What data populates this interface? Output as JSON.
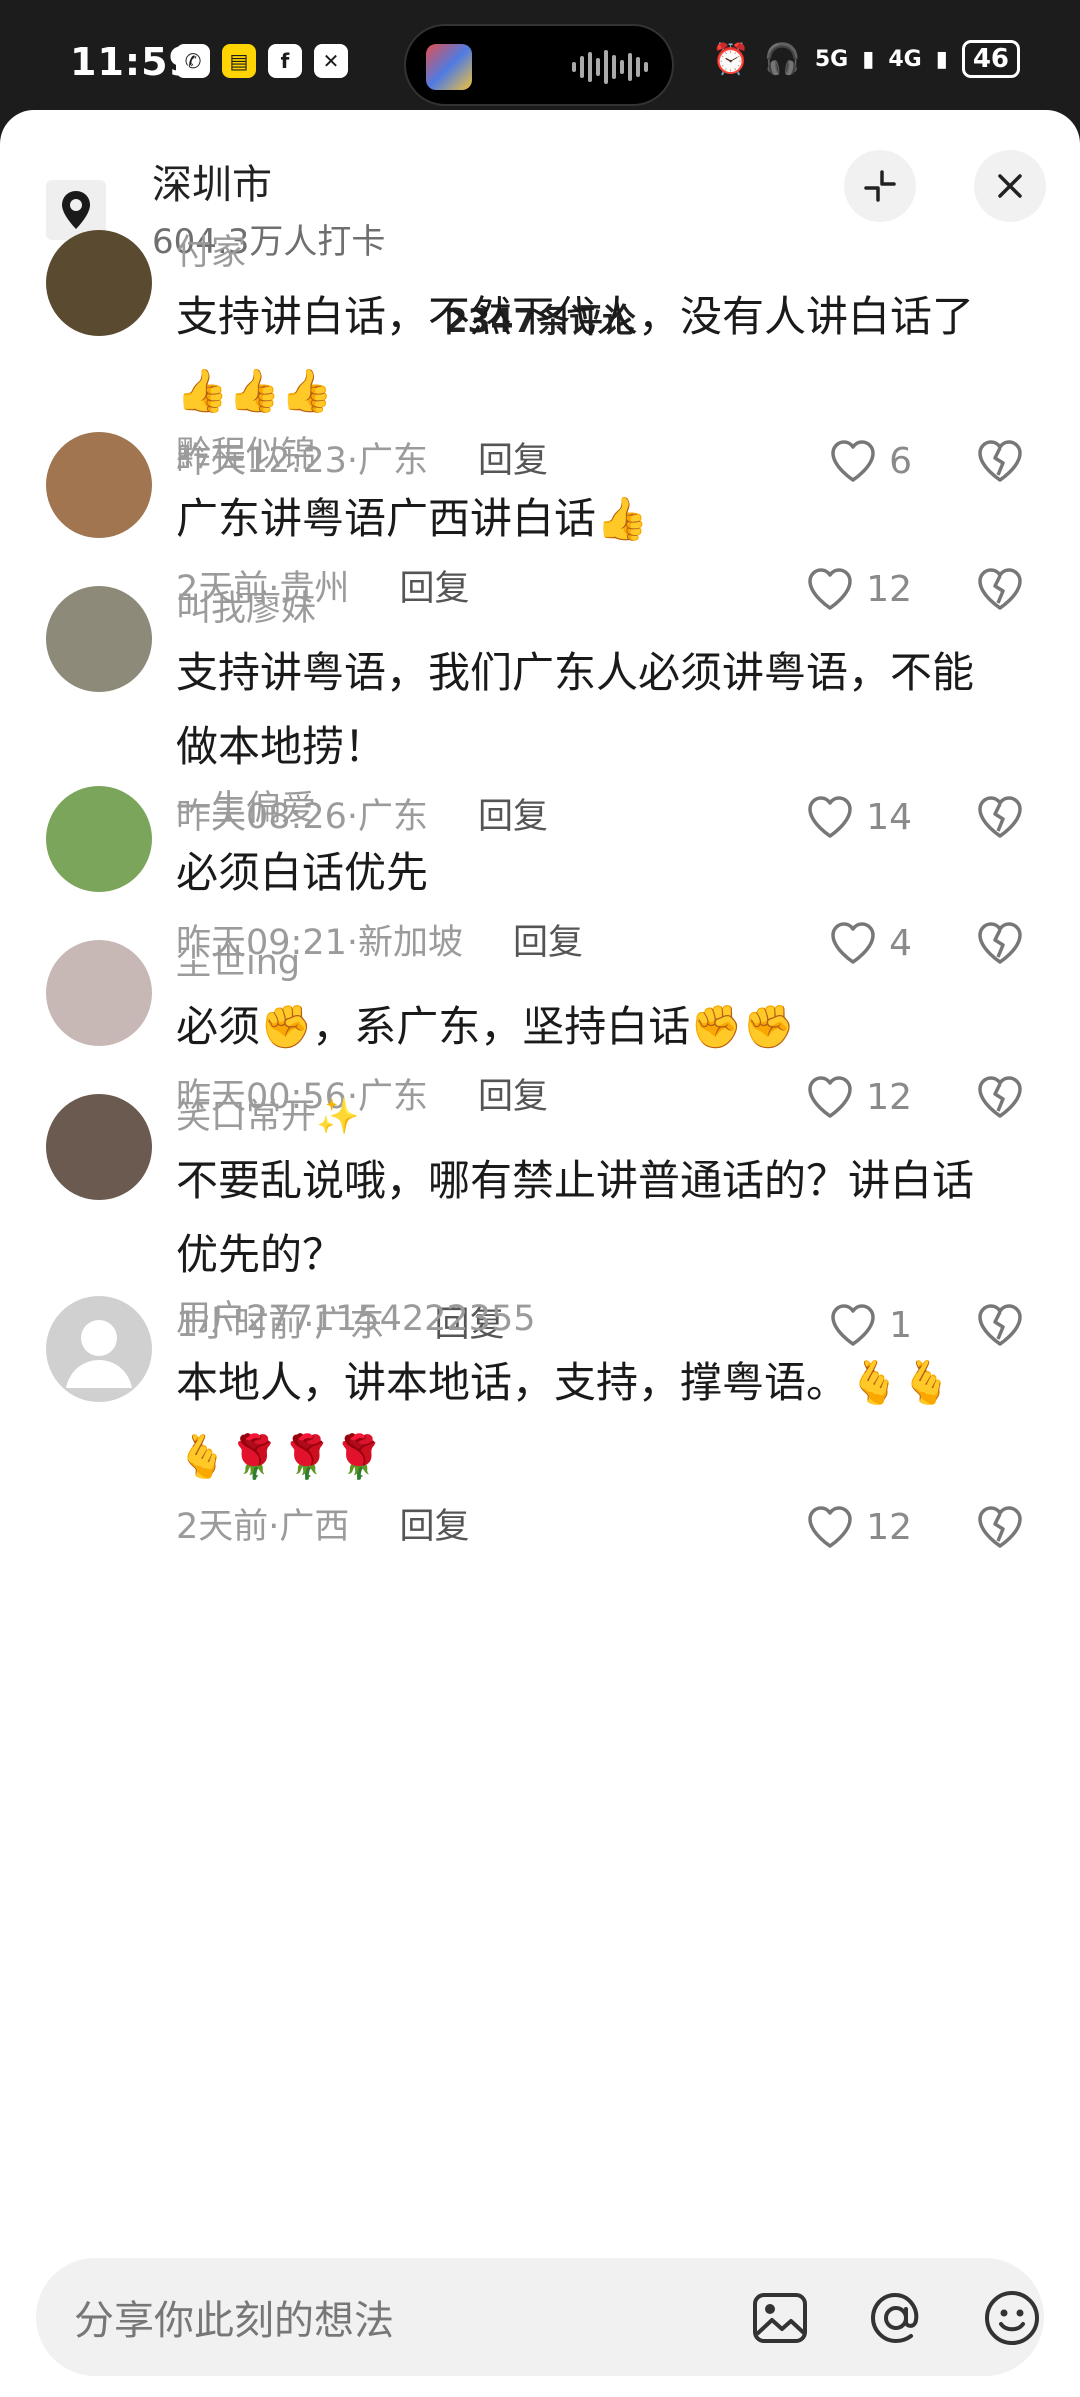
{
  "status_bar": {
    "time": "11:59",
    "battery": "46",
    "network_1": "5G",
    "network_2": "4G"
  },
  "header": {
    "location_name": "深圳市",
    "checkins": "604.3万人打卡",
    "comment_count": "2347条评论"
  },
  "comments": [
    {
      "user": "付家",
      "text_lines": [
        "支持讲白话，不然下代人，没有人讲白话了",
        "👍👍👍"
      ],
      "time": "昨天12:23",
      "region": "广东",
      "reply": "回复",
      "likes": "6",
      "avatar_color": "#5a4a30"
    },
    {
      "user": "黔程似锦",
      "text_lines": [
        "广东讲粤语广西讲白话👍"
      ],
      "time": "2天前",
      "region": "贵州",
      "reply": "回复",
      "likes": "12",
      "avatar_color": "#a07550"
    },
    {
      "user": "叫我廖妹",
      "text_lines": [
        "支持讲粤语，我们广东人必须讲粤语，不能",
        "做本地捞！"
      ],
      "time": "昨天08:26",
      "region": "广东",
      "reply": "回复",
      "likes": "14",
      "avatar_color": "#8d8a7a"
    },
    {
      "user": "一生偏爱",
      "text_lines": [
        "必须白话优先"
      ],
      "time": "昨天09:21",
      "region": "新加坡",
      "reply": "回复",
      "likes": "4",
      "avatar_color": "#7aa55a"
    },
    {
      "user": "尘世ing",
      "text_lines": [
        "必须✊，系广东，坚持白话✊✊"
      ],
      "time": "昨天00:56",
      "region": "广东",
      "reply": "回复",
      "likes": "12",
      "avatar_color": "#c7b8b5"
    },
    {
      "user": "笑口常开✨",
      "text_lines": [
        "不要乱说哦，哪有禁止讲普通话的？讲白话",
        "优先的？"
      ],
      "time": "1小时前",
      "region": "广东",
      "reply": "回复",
      "likes": "1",
      "avatar_color": "#6a5a50"
    },
    {
      "user": "用户2771154222355",
      "text_lines": [
        "本地人，讲本地话，支持，撑粤语。🫰🫰",
        "🫰🌹🌹🌹"
      ],
      "time": "2天前",
      "region": "广西",
      "reply": "回复",
      "likes": "12",
      "avatar_color": "#d0d0d0"
    }
  ],
  "input": {
    "placeholder": "分享你此刻的想法"
  },
  "icons": {
    "location": "location-pin-icon",
    "minimize": "minimize-icon",
    "close": "close-icon",
    "like": "heart-icon",
    "dislike": "broken-heart-icon",
    "image": "image-icon",
    "mention": "at-icon",
    "emoji": "emoji-icon"
  }
}
